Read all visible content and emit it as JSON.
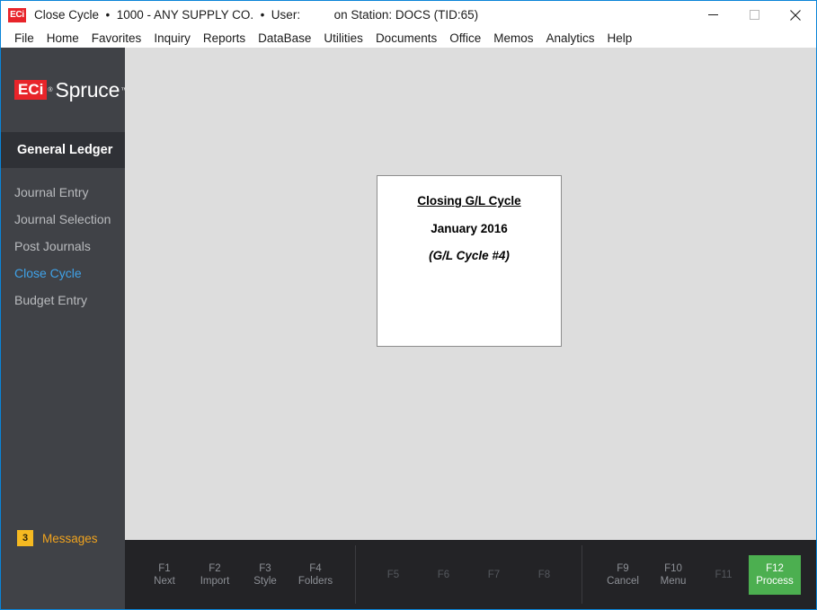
{
  "window": {
    "app_icon": "eci-logo-icon",
    "icon_text": "ECi",
    "title": "Close Cycle  •  1000 - ANY SUPPLY CO.  •  User:          on Station: DOCS (TID:65)",
    "controls": {
      "minimize": "minimize-icon",
      "maximize": "maximize-icon",
      "close": "close-icon"
    }
  },
  "menubar": {
    "items": [
      {
        "label": "File"
      },
      {
        "label": "Home"
      },
      {
        "label": "Favorites"
      },
      {
        "label": "Inquiry"
      },
      {
        "label": "Reports"
      },
      {
        "label": "DataBase"
      },
      {
        "label": "Utilities"
      },
      {
        "label": "Documents"
      },
      {
        "label": "Office"
      },
      {
        "label": "Memos"
      },
      {
        "label": "Analytics"
      },
      {
        "label": "Help"
      }
    ]
  },
  "sidebar": {
    "logo": {
      "mark": "ECi",
      "registered": "®",
      "word": "Spruce",
      "trademark": "™"
    },
    "module_title": "General Ledger",
    "items": [
      {
        "label": "Journal Entry",
        "active": false
      },
      {
        "label": "Journal Selection",
        "active": false
      },
      {
        "label": "Post Journals",
        "active": false
      },
      {
        "label": "Close Cycle",
        "active": true
      },
      {
        "label": "Budget Entry",
        "active": false
      }
    ],
    "messages": {
      "count": "3",
      "label": "Messages"
    }
  },
  "content": {
    "document": {
      "title": "Closing G/L Cycle",
      "period": "January 2016",
      "cycle": "(G/L Cycle #4)"
    }
  },
  "function_bar": {
    "groups": [
      {
        "keys": [
          {
            "key": "F1",
            "label": "Next",
            "state": "enabled"
          },
          {
            "key": "F2",
            "label": "Import",
            "state": "enabled"
          },
          {
            "key": "F3",
            "label": "Style",
            "state": "enabled"
          },
          {
            "key": "F4",
            "label": "Folders",
            "state": "enabled"
          }
        ]
      },
      {
        "keys": [
          {
            "key": "F5",
            "label": "",
            "state": "disabled"
          },
          {
            "key": "F6",
            "label": "",
            "state": "disabled"
          },
          {
            "key": "F7",
            "label": "",
            "state": "disabled"
          },
          {
            "key": "F8",
            "label": "",
            "state": "disabled"
          }
        ]
      },
      {
        "keys": [
          {
            "key": "F9",
            "label": "Cancel",
            "state": "enabled"
          },
          {
            "key": "F10",
            "label": "Menu",
            "state": "enabled"
          },
          {
            "key": "F11",
            "label": "",
            "state": "disabled"
          },
          {
            "key": "F12",
            "label": "Process",
            "state": "primary"
          }
        ]
      }
    ]
  },
  "colors": {
    "accent_blue": "#0a84d8",
    "brand_red": "#e8242a",
    "active_nav": "#3fa2e8",
    "primary_button": "#4caf50",
    "badge_yellow": "#f5b921",
    "sidebar_bg": "#404247",
    "fnbar_bg": "#232326",
    "content_bg": "#dddddd"
  }
}
